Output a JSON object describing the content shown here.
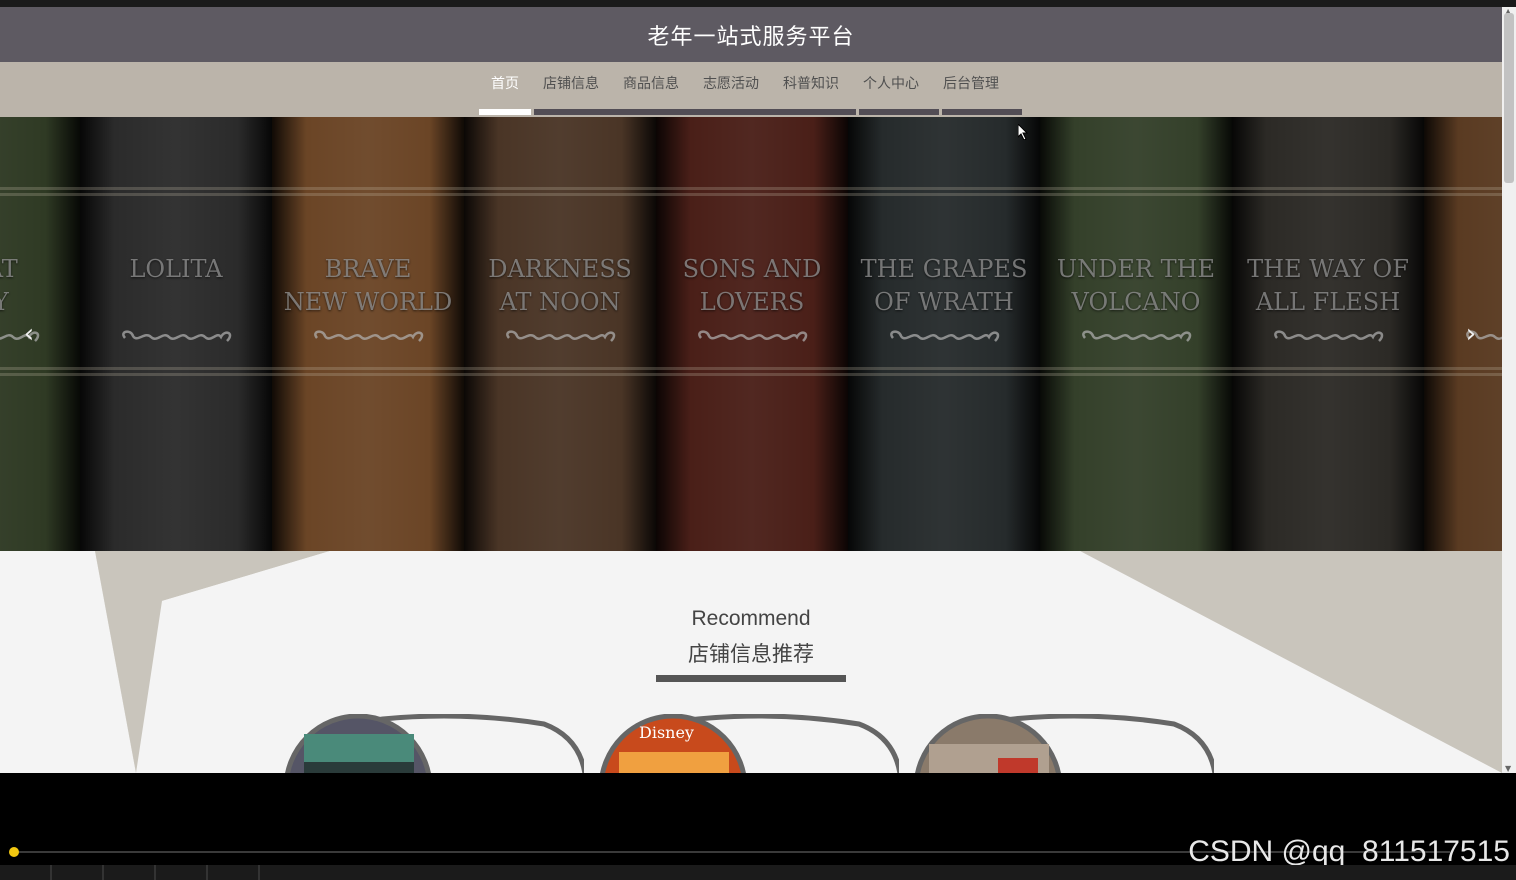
{
  "header": {
    "title": "老年一站式服务平台"
  },
  "nav": {
    "items": [
      {
        "label": "首页",
        "active": true
      },
      {
        "label": "店铺信息",
        "active": false
      },
      {
        "label": "商品信息",
        "active": false
      },
      {
        "label": "志愿活动",
        "active": false
      },
      {
        "label": "科普知识",
        "active": false
      },
      {
        "label": "个人中心",
        "active": false
      },
      {
        "label": "后台管理",
        "active": false
      }
    ]
  },
  "banner": {
    "books": [
      {
        "title": "REAT\nSBY",
        "color": "#2f3a24"
      },
      {
        "title": "LOLITA",
        "color": "#2b2b2b"
      },
      {
        "title": "BRAVE\nNEW WORLD",
        "color": "#6b4526"
      },
      {
        "title": "DARKNESS\nAT NOON",
        "color": "#4a3526"
      },
      {
        "title": "SONS AND\nLOVERS",
        "color": "#4a1f18"
      },
      {
        "title": "THE GRAPES\nOF WRATH",
        "color": "#262b2c"
      },
      {
        "title": "UNDER THE\nVOLCANO",
        "color": "#34402a"
      },
      {
        "title": "THE WAY OF\nALL FLESH",
        "color": "#2c2a26"
      },
      {
        "title": "",
        "color": "#5a3b22"
      }
    ],
    "prev_icon": "chevron-left-icon",
    "next_icon": "chevron-right-icon",
    "slides": 3,
    "current_slide": 2
  },
  "recommend": {
    "title_en": "Recommend",
    "title_cn": "店铺信息推荐"
  },
  "watermark": "CSDN @qq_811517515"
}
